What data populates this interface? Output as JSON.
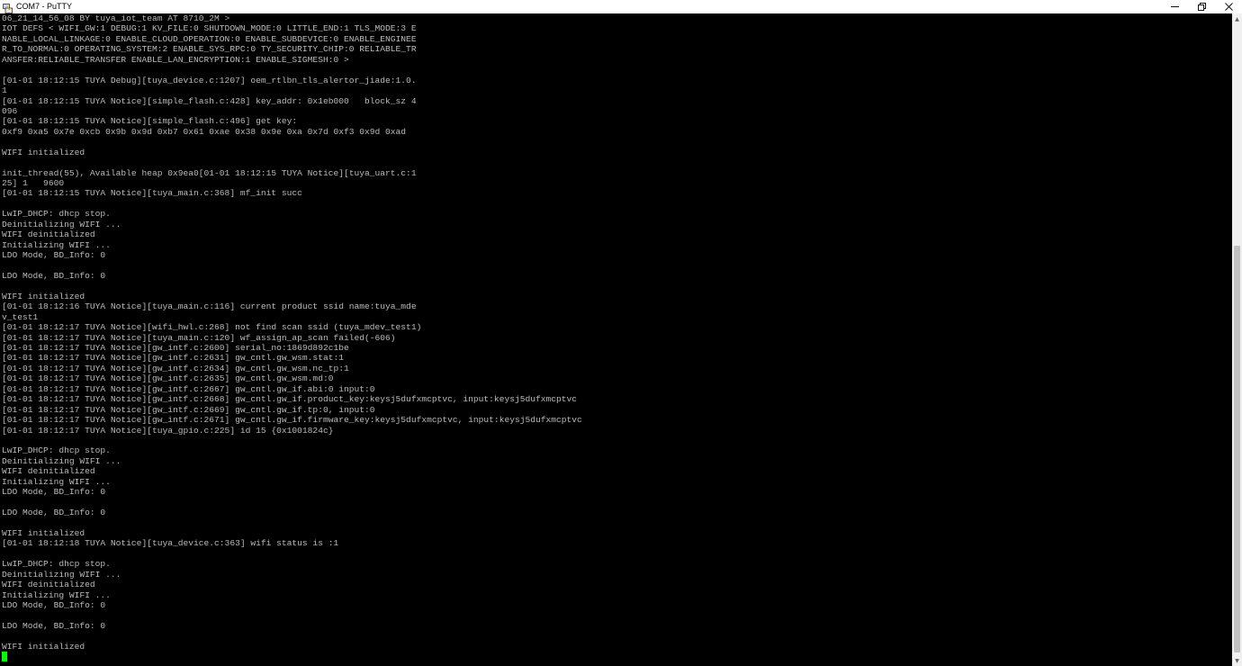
{
  "window": {
    "title": "COM7 - PuTTY",
    "icons": {
      "app": "putty-icon",
      "minimize": "minimize-icon",
      "restore": "restore-icon",
      "close": "close-icon"
    }
  },
  "terminal": {
    "colors": {
      "background": "#000000",
      "text": "#bbbbbb",
      "cursor": "#00ff00"
    },
    "lines": [
      "06_21_14_56_08 BY tuya_iot_team AT 8710_2M >",
      "IOT DEFS < WIFI_GW:1 DEBUG:1 KV_FILE:0 SHUTDOWN_MODE:0 LITTLE_END:1 TLS_MODE:3 E",
      "NABLE_LOCAL_LINKAGE:0 ENABLE_CLOUD_OPERATION:0 ENABLE_SUBDEVICE:0 ENABLE_ENGINEE",
      "R_TO_NORMAL:0 OPERATING_SYSTEM:2 ENABLE_SYS_RPC:0 TY_SECURITY_CHIP:0 RELIABLE_TR",
      "ANSFER:RELIABLE_TRANSFER ENABLE_LAN_ENCRYPTION:1 ENABLE_SIGMESH:0 >",
      "",
      "[01-01 18:12:15 TUYA Debug][tuya_device.c:1207] oem_rtlbn_tls_alertor_jiade:1.0.",
      "1",
      "[01-01 18:12:15 TUYA Notice][simple_flash.c:428] key_addr: 0x1eb000   block_sz 4",
      "096",
      "[01-01 18:12:15 TUYA Notice][simple_flash.c:496] get key:",
      "0xf9 0xa5 0x7e 0xcb 0x9b 0x9d 0xb7 0x61 0xae 0x38 0x9e 0xa 0x7d 0xf3 0x9d 0xad",
      "",
      "WIFI initialized",
      "",
      "init_thread(55), Available heap 0x9ea0[01-01 18:12:15 TUYA Notice][tuya_uart.c:1",
      "25] 1   9600",
      "[01-01 18:12:15 TUYA Notice][tuya_main.c:368] mf_init succ",
      "",
      "LwIP_DHCP: dhcp stop.",
      "Deinitializing WIFI ...",
      "WIFI deinitialized",
      "Initializing WIFI ...",
      "LDO Mode, BD_Info: 0",
      "",
      "LDO Mode, BD_Info: 0",
      "",
      "WIFI initialized",
      "[01-01 18:12:16 TUYA Notice][tuya_main.c:116] current product ssid name:tuya_mde",
      "v_test1",
      "[01-01 18:12:17 TUYA Notice][wifi_hwl.c:268] not find scan ssid (tuya_mdev_test1)",
      "[01-01 18:12:17 TUYA Notice][tuya_main.c:120] wf_assign_ap_scan failed(-606)",
      "[01-01 18:12:17 TUYA Notice][gw_intf.c:2600] serial_no:1869d892c1be",
      "[01-01 18:12:17 TUYA Notice][gw_intf.c:2631] gw_cntl.gw_wsm.stat:1",
      "[01-01 18:12:17 TUYA Notice][gw_intf.c:2634] gw_cntl.gw_wsm.nc_tp:1",
      "[01-01 18:12:17 TUYA Notice][gw_intf.c:2635] gw_cntl.gw_wsm.md:0",
      "[01-01 18:12:17 TUYA Notice][gw_intf.c:2667] gw_cntl.gw_if.abi:0 input:0",
      "[01-01 18:12:17 TUYA Notice][gw_intf.c:2668] gw_cntl.gw_if.product_key:keysj5dufxmcptvc, input:keysj5dufxmcptvc",
      "[01-01 18:12:17 TUYA Notice][gw_intf.c:2669] gw_cntl.gw_if.tp:0, input:0",
      "[01-01 18:12:17 TUYA Notice][gw_intf.c:2671] gw_cntl.gw_if.firmware_key:keysj5dufxmcptvc, input:keysj5dufxmcptvc",
      "[01-01 18:12:17 TUYA Notice][tuya_gpio.c:225] id 15 {0x1001824c}",
      "",
      "LwIP_DHCP: dhcp stop.",
      "Deinitializing WIFI ...",
      "WIFI deinitialized",
      "Initializing WIFI ...",
      "LDO Mode, BD_Info: 0",
      "",
      "LDO Mode, BD_Info: 0",
      "",
      "WIFI initialized",
      "[01-01 18:12:18 TUYA Notice][tuya_device.c:363] wifi status is :1",
      "",
      "LwIP_DHCP: dhcp stop.",
      "Deinitializing WIFI ...",
      "WIFI deinitialized",
      "Initializing WIFI ...",
      "LDO Mode, BD_Info: 0",
      "",
      "LDO Mode, BD_Info: 0",
      "",
      "WIFI initialized"
    ]
  },
  "scrollbar": {
    "up_icon": "scroll-up-arrow-icon",
    "down_icon": "scroll-down-arrow-icon"
  }
}
